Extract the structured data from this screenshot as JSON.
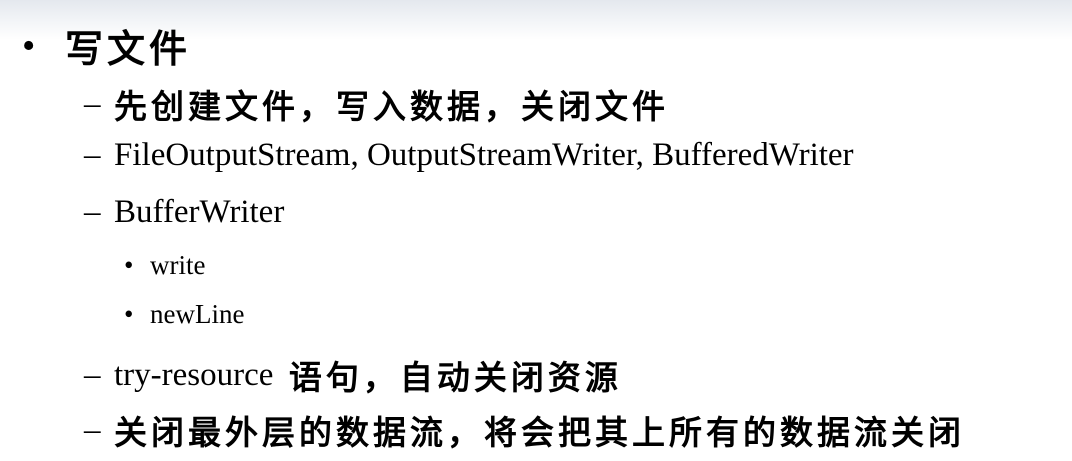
{
  "slide": {
    "heading": {
      "bullet": "•",
      "text": "写文件"
    },
    "items": [
      {
        "marker": "–",
        "text": "先创建文件，写入数据，关闭文件"
      },
      {
        "marker": "–",
        "text": "FileOutputStream, OutputStreamWriter, BufferedWriter"
      },
      {
        "marker": "–",
        "text": "BufferWriter"
      },
      {
        "marker": "•",
        "text": "write"
      },
      {
        "marker": "•",
        "text": "newLine"
      },
      {
        "marker": "–",
        "text_latin": "try-resource",
        "text_cjk": " 语句，自动关闭资源"
      },
      {
        "marker": "–",
        "text": "关闭最外层的数据流，将会把其上所有的数据流关闭"
      }
    ]
  }
}
